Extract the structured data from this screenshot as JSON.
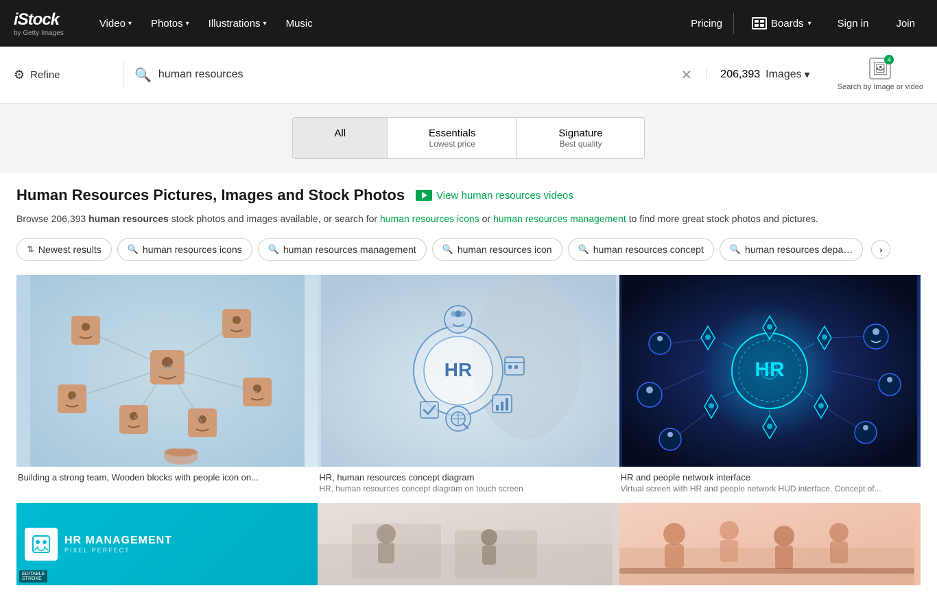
{
  "header": {
    "logo": "iStock",
    "logo_sub": "by Getty Images",
    "nav": [
      {
        "label": "Video",
        "has_dropdown": true
      },
      {
        "label": "Photos",
        "has_dropdown": true
      },
      {
        "label": "Illustrations",
        "has_dropdown": true
      },
      {
        "label": "Music",
        "has_dropdown": false
      }
    ],
    "pricing": "Pricing",
    "boards": "Boards",
    "sign_in": "Sign in",
    "join": "Join",
    "notification": "4"
  },
  "search": {
    "query": "human resources",
    "results_count": "206,393",
    "filter_type": "Images",
    "search_by_image_label": "Search by Image\nor video",
    "placeholder": "human resources"
  },
  "filter_tabs": [
    {
      "label": "All",
      "sub": "",
      "active": true
    },
    {
      "label": "Essentials",
      "sub": "Lowest price",
      "active": false
    },
    {
      "label": "Signature",
      "sub": "Best quality",
      "active": false
    }
  ],
  "page": {
    "title": "Human Resources Pictures, Images and Stock Photos",
    "video_link": "View human resources videos",
    "browse_text_1": "Browse 206,393",
    "browse_keyword": "human resources",
    "browse_text_2": "stock photos and images available, or search for",
    "browse_link_1": "human resources icons",
    "browse_text_3": "or",
    "browse_link_2": "human resources management",
    "browse_text_4": "to find more great stock photos and pictures."
  },
  "chips": [
    {
      "label": "Newest results",
      "icon": "filter",
      "type": "sort"
    },
    {
      "label": "human resources icons",
      "icon": "search"
    },
    {
      "label": "human resources management",
      "icon": "search"
    },
    {
      "label": "human resources icon",
      "icon": "search"
    },
    {
      "label": "human resources concept",
      "icon": "search"
    },
    {
      "label": "human resources depa…",
      "icon": "search"
    }
  ],
  "images": [
    {
      "id": "img1",
      "caption": "Building a strong team, Wooden blocks with people icon on...",
      "type": "wooden-blocks"
    },
    {
      "id": "img2",
      "caption": "HR, human resources concept diagram",
      "subcaption": "HR, human resources concept diagram on touch screen",
      "type": "hr-concept"
    },
    {
      "id": "img3",
      "caption": "HR and people network interface",
      "subcaption": "Virtual screen with HR and people network HUD interface. Concept of...",
      "type": "hr-network"
    }
  ],
  "bottom_images": [
    {
      "id": "img4",
      "type": "hr-management",
      "title": "HR MANAGEMENT",
      "subtitle": "PIXEL PERFECT"
    },
    {
      "id": "img5",
      "type": "office-scene"
    },
    {
      "id": "img6",
      "type": "team-photo"
    }
  ]
}
